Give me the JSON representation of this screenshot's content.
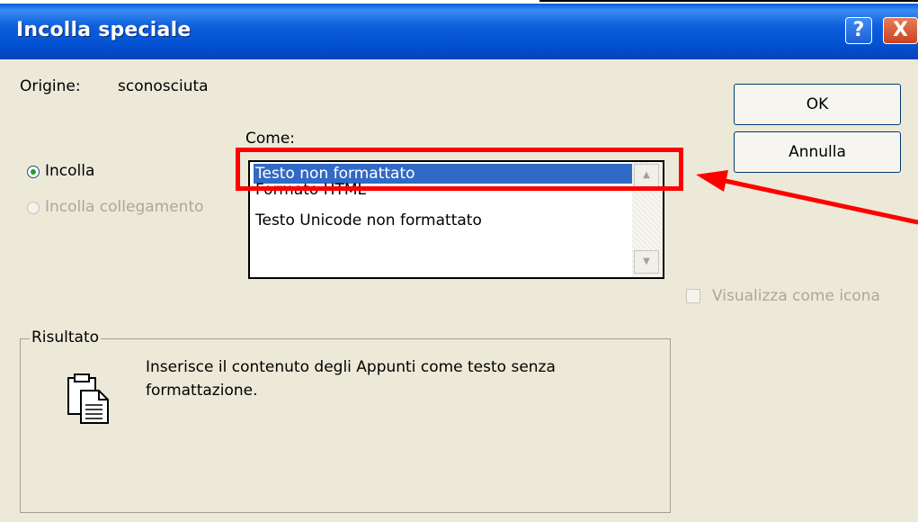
{
  "dialog": {
    "title": "Incolla speciale",
    "help_symbol": "?",
    "close_symbol": "X"
  },
  "source": {
    "label": "Origine:",
    "value": "sconosciuta"
  },
  "as_label": "Come:",
  "options": {
    "paste": "Incolla",
    "paste_link": "Incolla collegamento"
  },
  "formats": [
    "Testo non formattato",
    "Formato HTML",
    "Testo Unicode non formattato"
  ],
  "buttons": {
    "ok": "OK",
    "cancel": "Annulla"
  },
  "display_as_icon": "Visualizza come icona",
  "result": {
    "label": "Risultato",
    "description_line1": "Inserisce il contenuto degli Appunti come testo senza",
    "description_line2": "formattazione."
  },
  "colors": {
    "annotation": "#ff0000",
    "selection": "#316ac5"
  },
  "icons": {
    "help": "help-icon",
    "close": "close-icon",
    "clipboard": "clipboard-icon",
    "scroll_up": "scroll-up-icon",
    "scroll_down": "scroll-down-icon"
  }
}
